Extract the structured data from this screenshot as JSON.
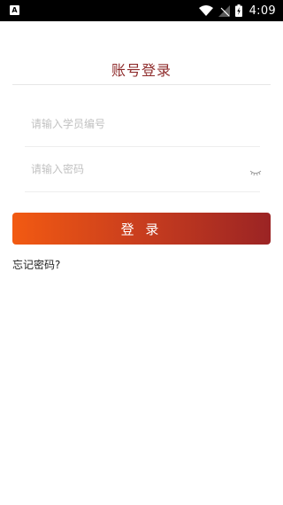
{
  "status_bar": {
    "notification_icon": "A",
    "time": "4:09",
    "icons": [
      "wifi-icon",
      "signal-icon",
      "battery-charging-icon"
    ]
  },
  "header": {
    "title": "账号登录"
  },
  "form": {
    "username": {
      "placeholder": "请输入学员编号",
      "value": ""
    },
    "password": {
      "placeholder": "请输入密码",
      "value": "",
      "toggle_icon": "eye-closed-icon"
    },
    "login_label": "登 录",
    "forgot_label": "忘记密码?"
  },
  "colors": {
    "title": "#8e2b2b",
    "button_gradient_start": "#f25a12",
    "button_gradient_end": "#9b2424"
  }
}
